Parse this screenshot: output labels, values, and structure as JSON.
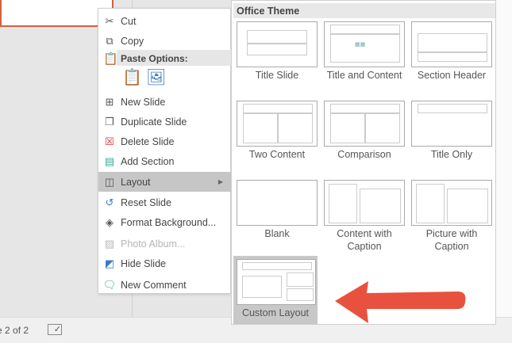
{
  "status_bar": {
    "slide_counter": "e 2 of 2"
  },
  "context_menu": {
    "items": [
      {
        "label": "Cut",
        "icon": "scissors-icon"
      },
      {
        "label": "Copy",
        "icon": "copy-icon"
      },
      {
        "label": "New Slide",
        "icon": "new-slide-icon"
      },
      {
        "label": "Duplicate Slide",
        "icon": "duplicate-slide-icon"
      },
      {
        "label": "Delete Slide",
        "icon": "delete-slide-icon"
      },
      {
        "label": "Add Section",
        "icon": "section-icon"
      },
      {
        "label": "Layout",
        "icon": "layout-icon",
        "active": true
      },
      {
        "label": "Reset Slide",
        "icon": "reset-icon"
      },
      {
        "label": "Format Background...",
        "icon": "paint-bucket-icon"
      },
      {
        "label": "Photo Album...",
        "icon": "photo-album-icon",
        "disabled": true
      },
      {
        "label": "Hide Slide",
        "icon": "hide-slide-icon"
      },
      {
        "label": "New Comment",
        "icon": "comment-icon"
      }
    ],
    "paste_options_label": "Paste Options:"
  },
  "layout_gallery": {
    "header": "Office Theme",
    "layouts": [
      "Title Slide",
      "Title and Content",
      "Section Header",
      "Two Content",
      "Comparison",
      "Title Only",
      "Blank",
      "Content with Caption",
      "Picture with Caption",
      "Custom Layout"
    ],
    "selected": "Custom Layout"
  },
  "colors": {
    "arrow": "#e8513d",
    "slide_border": "#d4603c",
    "highlight": "#c6c6c6"
  }
}
